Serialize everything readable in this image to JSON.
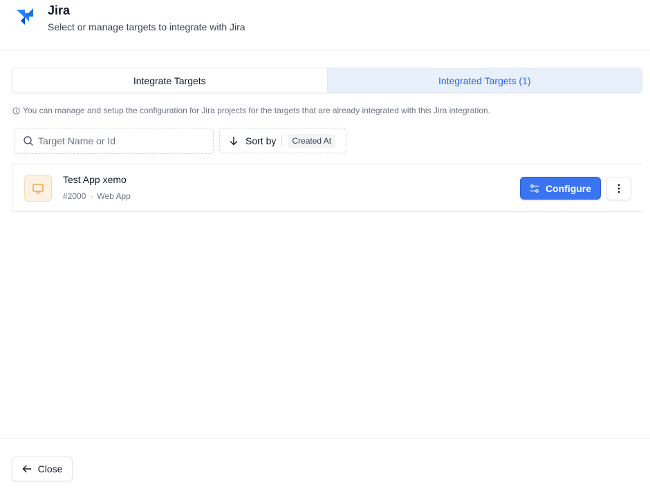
{
  "header": {
    "title": "Jira",
    "subtitle": "Select or manage targets to integrate with Jira",
    "logo": "jira-logo"
  },
  "tabs": [
    {
      "label": "Integrate Targets",
      "active": false
    },
    {
      "label": "Integrated Targets (1)",
      "active": true
    }
  ],
  "info_text": "You can manage and setup the configuration for Jira projects for the targets that are already integrated with this Jira integration.",
  "search": {
    "placeholder": "Target Name or Id",
    "value": ""
  },
  "sort": {
    "label": "Sort by",
    "value": "Created At",
    "direction": "descending"
  },
  "targets": [
    {
      "name": "Test App xemo",
      "id": "#2000",
      "type": "Web App",
      "icon": "monitor-icon",
      "configure_label": "Configure"
    }
  ],
  "footer": {
    "close_label": "Close"
  },
  "colors": {
    "accent": "#3b74f0",
    "tab_active_bg": "#e8f0fc",
    "tab_active_text": "#2563eb",
    "app_icon_bg": "#fdf1e3",
    "app_icon_stroke": "#e8993a"
  }
}
